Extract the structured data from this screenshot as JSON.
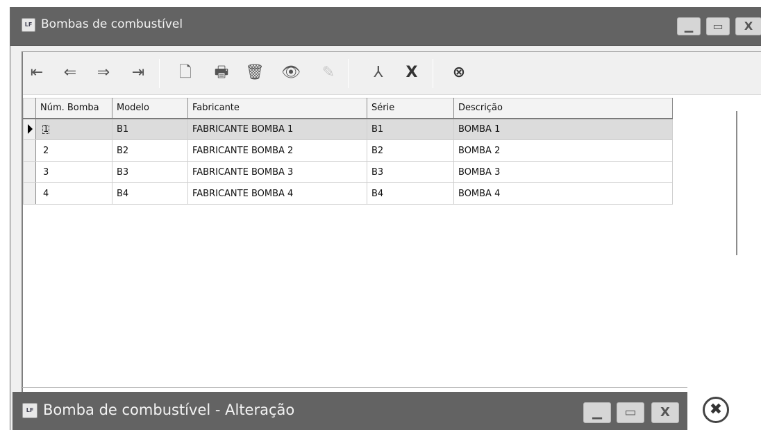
{
  "window": {
    "title": "Bombas de combustível",
    "icon_text": "LF",
    "controls": {
      "minimize": "▁",
      "maximize": "▭",
      "close": "X"
    }
  },
  "toolbar": {
    "first": "⇤",
    "prev": "⇐",
    "next": "⇒",
    "last": "⇥",
    "new": "🗋",
    "print": "🖶",
    "delete": "🗑",
    "view": "👁",
    "edit": "✎",
    "pdf": "⅄",
    "excel": "X",
    "close": "⊗"
  },
  "grid": {
    "columns": [
      "Núm. Bomba",
      "Modelo",
      "Fabricante",
      "Série",
      "Descrição"
    ],
    "rows": [
      [
        "1",
        "B1",
        "FABRICANTE BOMBA 1",
        "B1",
        "BOMBA 1"
      ],
      [
        "2",
        "B2",
        "FABRICANTE BOMBA 2",
        "B2",
        "BOMBA 2"
      ],
      [
        "3",
        "B3",
        "FABRICANTE BOMBA 3",
        "B3",
        "BOMBA 3"
      ],
      [
        "4",
        "B4",
        "FABRICANTE BOMBA 4",
        "B4",
        "BOMBA 4"
      ]
    ]
  },
  "window2": {
    "title": "Bomba de combustível - Alteração",
    "icon_text": "LF",
    "controls": {
      "minimize": "▁",
      "maximize": "▭",
      "close": "X"
    }
  },
  "outer_close": "✖"
}
